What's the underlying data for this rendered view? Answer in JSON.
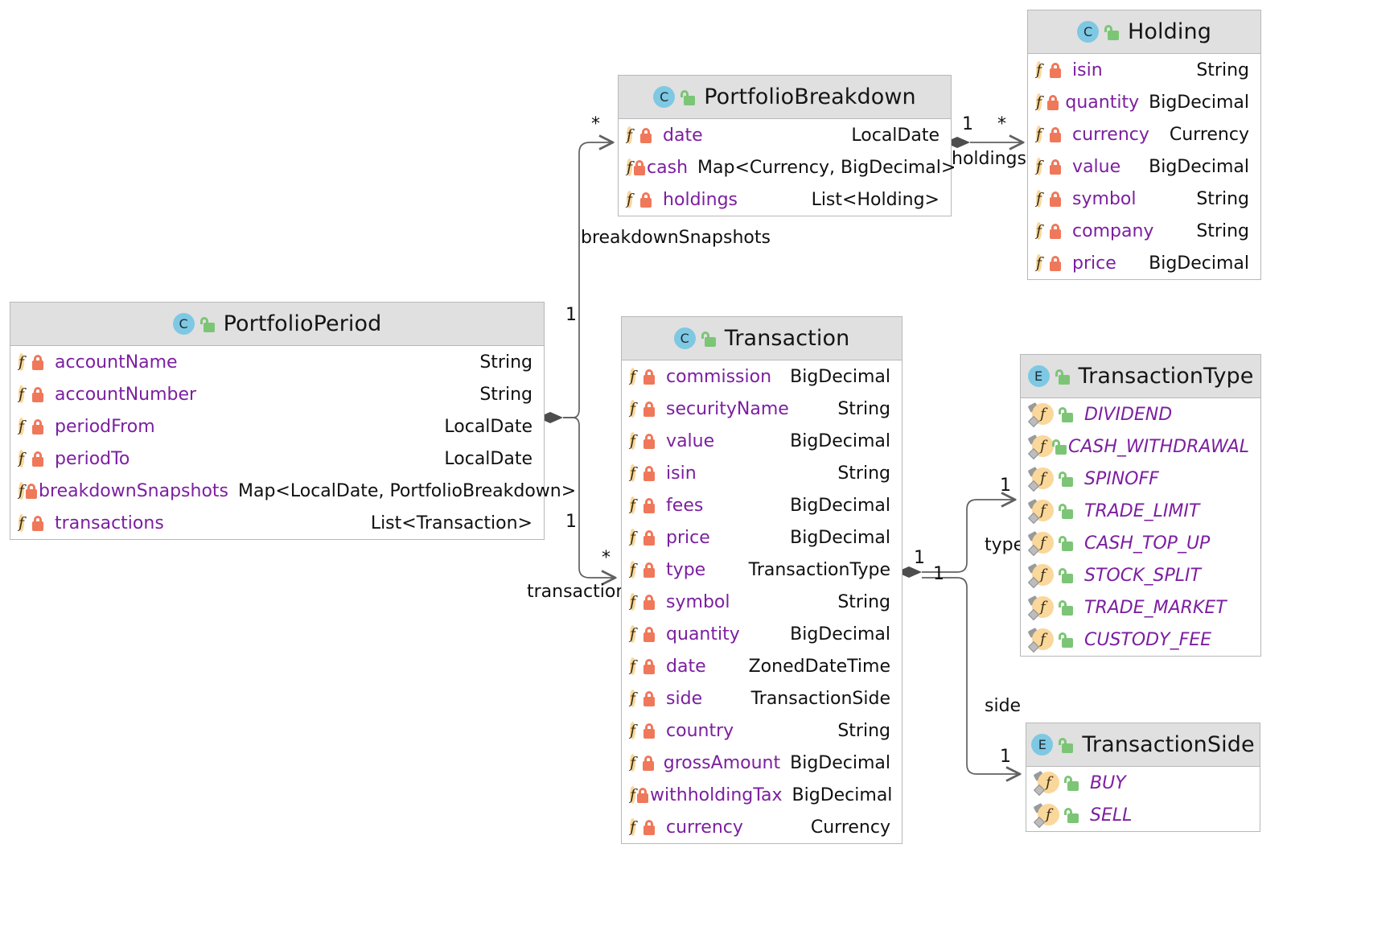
{
  "diagram": {
    "type": "uml-class-diagram",
    "colors": {
      "header_bg": "#e0e0e0",
      "border": "#b8b8b8",
      "field_name": "#7c1fa0",
      "field_icon": "#fad79a",
      "class_icon": "#7ec8e3",
      "lock_private": "#f0785a",
      "lock_public": "#7cc576",
      "edge": "#606060"
    },
    "classes": [
      {
        "id": "portfolioPeriod",
        "name": "PortfolioPeriod",
        "stereotype_icon": "class-icon",
        "stereotype_letter": "C",
        "visibility_icon": "unlocked-icon",
        "fields": [
          {
            "icon": "field-icon",
            "lock": "locked-icon",
            "name": "accountName",
            "type": "String"
          },
          {
            "icon": "field-icon",
            "lock": "locked-icon",
            "name": "accountNumber",
            "type": "String"
          },
          {
            "icon": "field-icon",
            "lock": "locked-icon",
            "name": "periodFrom",
            "type": "LocalDate"
          },
          {
            "icon": "field-icon",
            "lock": "locked-icon",
            "name": "periodTo",
            "type": "LocalDate"
          },
          {
            "icon": "field-icon",
            "lock": "locked-icon",
            "name": "breakdownSnapshots",
            "type": "Map<LocalDate, PortfolioBreakdown>"
          },
          {
            "icon": "field-icon",
            "lock": "locked-icon",
            "name": "transactions",
            "type": "List<Transaction>"
          }
        ]
      },
      {
        "id": "portfolioBreakdown",
        "name": "PortfolioBreakdown",
        "stereotype_icon": "class-icon",
        "stereotype_letter": "C",
        "visibility_icon": "unlocked-icon",
        "fields": [
          {
            "icon": "field-icon",
            "lock": "locked-icon",
            "name": "date",
            "type": "LocalDate"
          },
          {
            "icon": "field-icon",
            "lock": "locked-icon",
            "name": "cash",
            "type": "Map<Currency, BigDecimal>"
          },
          {
            "icon": "field-icon",
            "lock": "locked-icon",
            "name": "holdings",
            "type": "List<Holding>"
          }
        ]
      },
      {
        "id": "holding",
        "name": "Holding",
        "stereotype_icon": "class-icon",
        "stereotype_letter": "C",
        "visibility_icon": "unlocked-icon",
        "fields": [
          {
            "icon": "field-icon",
            "lock": "locked-icon",
            "name": "isin",
            "type": "String"
          },
          {
            "icon": "field-icon",
            "lock": "locked-icon",
            "name": "quantity",
            "type": "BigDecimal"
          },
          {
            "icon": "field-icon",
            "lock": "locked-icon",
            "name": "currency",
            "type": "Currency"
          },
          {
            "icon": "field-icon",
            "lock": "locked-icon",
            "name": "value",
            "type": "BigDecimal"
          },
          {
            "icon": "field-icon",
            "lock": "locked-icon",
            "name": "symbol",
            "type": "String"
          },
          {
            "icon": "field-icon",
            "lock": "locked-icon",
            "name": "company",
            "type": "String"
          },
          {
            "icon": "field-icon",
            "lock": "locked-icon",
            "name": "price",
            "type": "BigDecimal"
          }
        ]
      },
      {
        "id": "transaction",
        "name": "Transaction",
        "stereotype_icon": "class-icon",
        "stereotype_letter": "C",
        "visibility_icon": "unlocked-icon",
        "fields": [
          {
            "icon": "field-icon",
            "lock": "locked-icon",
            "name": "commission",
            "type": "BigDecimal"
          },
          {
            "icon": "field-icon",
            "lock": "locked-icon",
            "name": "securityName",
            "type": "String"
          },
          {
            "icon": "field-icon",
            "lock": "locked-icon",
            "name": "value",
            "type": "BigDecimal"
          },
          {
            "icon": "field-icon",
            "lock": "locked-icon",
            "name": "isin",
            "type": "String"
          },
          {
            "icon": "field-icon",
            "lock": "locked-icon",
            "name": "fees",
            "type": "BigDecimal"
          },
          {
            "icon": "field-icon",
            "lock": "locked-icon",
            "name": "price",
            "type": "BigDecimal"
          },
          {
            "icon": "field-icon",
            "lock": "locked-icon",
            "name": "type",
            "type": "TransactionType"
          },
          {
            "icon": "field-icon",
            "lock": "locked-icon",
            "name": "symbol",
            "type": "String"
          },
          {
            "icon": "field-icon",
            "lock": "locked-icon",
            "name": "quantity",
            "type": "BigDecimal"
          },
          {
            "icon": "field-icon",
            "lock": "locked-icon",
            "name": "date",
            "type": "ZonedDateTime"
          },
          {
            "icon": "field-icon",
            "lock": "locked-icon",
            "name": "side",
            "type": "TransactionSide"
          },
          {
            "icon": "field-icon",
            "lock": "locked-icon",
            "name": "country",
            "type": "String"
          },
          {
            "icon": "field-icon",
            "lock": "locked-icon",
            "name": "grossAmount",
            "type": "BigDecimal"
          },
          {
            "icon": "field-icon",
            "lock": "locked-icon",
            "name": "withholdingTax",
            "type": "BigDecimal"
          },
          {
            "icon": "field-icon",
            "lock": "locked-icon",
            "name": "currency",
            "type": "Currency"
          }
        ]
      },
      {
        "id": "transactionType",
        "name": "TransactionType",
        "stereotype_icon": "enum-icon",
        "stereotype_letter": "E",
        "visibility_icon": "unlocked-icon",
        "fields": [
          {
            "icon": "enum-constant-icon",
            "lock": "unlocked-icon",
            "name": "DIVIDEND",
            "type": ""
          },
          {
            "icon": "enum-constant-icon",
            "lock": "unlocked-icon",
            "name": "CASH_WITHDRAWAL",
            "type": ""
          },
          {
            "icon": "enum-constant-icon",
            "lock": "unlocked-icon",
            "name": "SPINOFF",
            "type": ""
          },
          {
            "icon": "enum-constant-icon",
            "lock": "unlocked-icon",
            "name": "TRADE_LIMIT",
            "type": ""
          },
          {
            "icon": "enum-constant-icon",
            "lock": "unlocked-icon",
            "name": "CASH_TOP_UP",
            "type": ""
          },
          {
            "icon": "enum-constant-icon",
            "lock": "unlocked-icon",
            "name": "STOCK_SPLIT",
            "type": ""
          },
          {
            "icon": "enum-constant-icon",
            "lock": "unlocked-icon",
            "name": "TRADE_MARKET",
            "type": ""
          },
          {
            "icon": "enum-constant-icon",
            "lock": "unlocked-icon",
            "name": "CUSTODY_FEE",
            "type": ""
          }
        ]
      },
      {
        "id": "transactionSide",
        "name": "TransactionSide",
        "stereotype_icon": "enum-icon",
        "stereotype_letter": "E",
        "visibility_icon": "unlocked-icon",
        "fields": [
          {
            "icon": "enum-constant-icon",
            "lock": "unlocked-icon",
            "name": "BUY",
            "type": ""
          },
          {
            "icon": "enum-constant-icon",
            "lock": "unlocked-icon",
            "name": "SELL",
            "type": ""
          }
        ]
      }
    ],
    "relations": [
      {
        "id": "rel-breakdownSnapshots",
        "from": "portfolioPeriod",
        "to": "portfolioBreakdown",
        "label": "breakdownSnapshots",
        "source_mult": "1",
        "target_mult": "*",
        "kind": "composition"
      },
      {
        "id": "rel-transactions",
        "from": "portfolioPeriod",
        "to": "transaction",
        "label": "transactions",
        "source_mult": "1",
        "target_mult": "*",
        "kind": "composition"
      },
      {
        "id": "rel-holdings",
        "from": "portfolioBreakdown",
        "to": "holding",
        "label": "holdings",
        "source_mult": "1",
        "target_mult": "*",
        "kind": "composition"
      },
      {
        "id": "rel-type",
        "from": "transaction",
        "to": "transactionType",
        "label": "type",
        "source_mult": "1",
        "target_mult": "1",
        "kind": "composition"
      },
      {
        "id": "rel-side",
        "from": "transaction",
        "to": "transactionSide",
        "label": "side",
        "source_mult": "1",
        "target_mult": "1",
        "kind": "composition"
      }
    ]
  }
}
